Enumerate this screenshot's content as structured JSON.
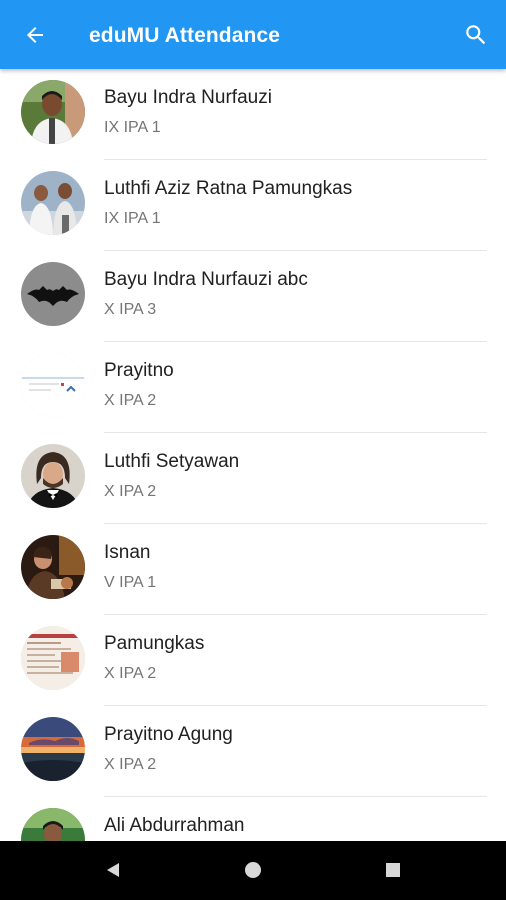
{
  "app_bar": {
    "title": "eduMU Attendance",
    "back_icon": "arrow-left-icon",
    "search_icon": "search-icon",
    "color": "#2196f3"
  },
  "students": [
    {
      "name": "Bayu Indra Nurfauzi",
      "class": "IX IPA 1"
    },
    {
      "name": "Luthfi Aziz Ratna Pamungkas",
      "class": "IX IPA 1"
    },
    {
      "name": "Bayu Indra Nurfauzi abc",
      "class": "X IPA 3"
    },
    {
      "name": "Prayitno",
      "class": "X IPA 2"
    },
    {
      "name": "Luthfi Setyawan",
      "class": "X IPA 2"
    },
    {
      "name": "Isnan",
      "class": "V IPA 1"
    },
    {
      "name": "Pamungkas",
      "class": "X IPA 2"
    },
    {
      "name": "Prayitno Agung",
      "class": "X IPA 2"
    },
    {
      "name": "Ali Abdurrahman",
      "class": ""
    }
  ],
  "nav_bar": {
    "back_icon": "triangle-back-icon",
    "home_icon": "circle-home-icon",
    "recents_icon": "square-recents-icon"
  }
}
